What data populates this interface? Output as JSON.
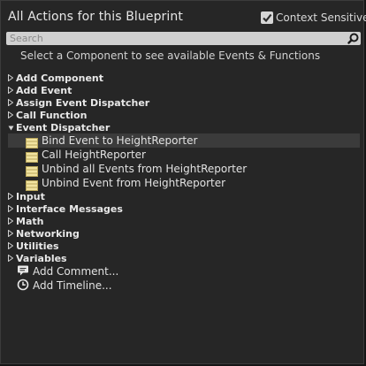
{
  "header": {
    "title": "All Actions for this Blueprint",
    "context_sensitive_label": "Context Sensitive",
    "context_sensitive_checked": true
  },
  "search": {
    "placeholder": "Search",
    "value": ""
  },
  "hint": "Select a Component to see available Events & Functions",
  "categories": [
    {
      "label": "Add Component",
      "expanded": false
    },
    {
      "label": "Add Event",
      "expanded": false
    },
    {
      "label": "Assign Event Dispatcher",
      "expanded": false
    },
    {
      "label": "Call Function",
      "expanded": false
    },
    {
      "label": "Event Dispatcher",
      "expanded": true
    },
    {
      "label": "Input",
      "expanded": false
    },
    {
      "label": "Interface Messages",
      "expanded": false
    },
    {
      "label": "Math",
      "expanded": false
    },
    {
      "label": "Networking",
      "expanded": false
    },
    {
      "label": "Utilities",
      "expanded": false
    },
    {
      "label": "Variables",
      "expanded": false
    }
  ],
  "event_dispatcher_items": [
    {
      "label": "Bind Event to HeightReporter",
      "selected": true
    },
    {
      "label": "Call HeightReporter",
      "selected": false
    },
    {
      "label": "Unbind all Events from HeightReporter",
      "selected": false
    },
    {
      "label": "Unbind Event from HeightReporter",
      "selected": false
    }
  ],
  "misc_actions": [
    {
      "label": "Add Comment...",
      "icon": "comment-icon"
    },
    {
      "label": "Add Timeline...",
      "icon": "clock-icon"
    }
  ],
  "colors": {
    "panel_bg": "#262626",
    "selected_row": "#3b3b3b",
    "text": "#e2e2e2",
    "dispatcher_icon": "#f3e6a6"
  }
}
